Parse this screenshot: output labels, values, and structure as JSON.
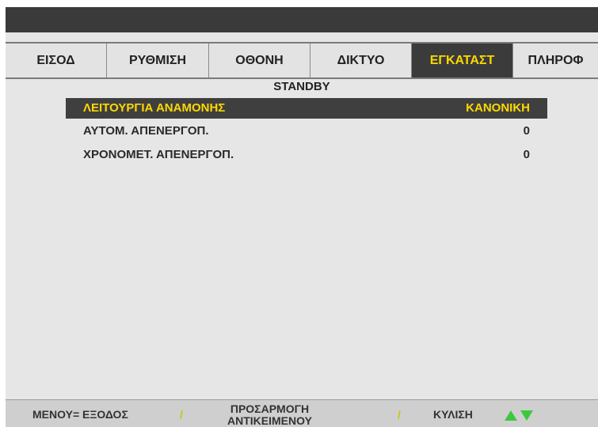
{
  "tabs": [
    {
      "label": "ΕΙΣΟΔ",
      "active": false
    },
    {
      "label": "ΡΥΘΜΙΣΗ",
      "active": false
    },
    {
      "label": "ΟΘΟΝΗ",
      "active": false
    },
    {
      "label": "ΔΙΚΤΥΟ",
      "active": false
    },
    {
      "label": "ΕΓΚΑΤΑΣΤ",
      "active": true
    },
    {
      "label": "ΠΛΗΡΟΦ",
      "active": false
    }
  ],
  "section_title": "STANDBY",
  "rows": [
    {
      "label": "ΛΕΙΤΟΥΡΓΙΑ ΑΝΑΜΟΝΗΣ",
      "value": "ΚΑΝΟΝΙΚΗ",
      "selected": true
    },
    {
      "label": "ΑΥΤΟΜ. ΑΠΕΝΕΡΓΟΠ.",
      "value": "0",
      "selected": false
    },
    {
      "label": "ΧΡΟΝΟΜΕΤ. ΑΠΕΝΕΡΓΟΠ.",
      "value": "0",
      "selected": false
    }
  ],
  "footer": {
    "menu_exit": "ΜΕΝΟΥ= ΕΞΟΔΟΣ",
    "separator": "/",
    "adjust_line1": "ΠΡΟΣΑΡΜΟΓΗ",
    "adjust_line2": "ΑΝΤΙΚΕΙΜΕΝΟΥ",
    "scroll": "ΚΥΛΙΣΗ",
    "scroll_up_icon": "arrow-up-icon",
    "scroll_down_icon": "arrow-down-icon"
  },
  "colors": {
    "active_text": "#ffd800",
    "selected_bg": "#3f3f3f",
    "arrow": "#3cc83c"
  }
}
